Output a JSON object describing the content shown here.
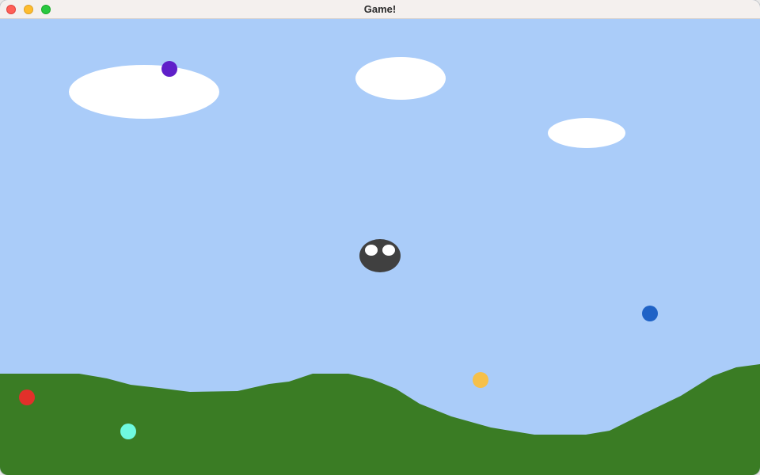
{
  "window": {
    "title": "Game!",
    "buttons": [
      {
        "name": "close",
        "color": "#ff5f57"
      },
      {
        "name": "minimize",
        "color": "#febc2e"
      },
      {
        "name": "maximize",
        "color": "#28c840"
      }
    ]
  },
  "colors": {
    "sky": "#aaccf9",
    "ground": "#3a7c24",
    "cloud": "#ffffff",
    "player_body": "#404040",
    "player_eye": "#ffffff"
  },
  "clouds": [
    "cloud",
    "cloud",
    "cloud"
  ],
  "player": {
    "name": "player",
    "eye_count": 2
  },
  "collectibles": [
    {
      "name": "purple-orb",
      "color": "#5f1fc9"
    },
    {
      "name": "blue-orb",
      "color": "#1f62c6"
    },
    {
      "name": "yellow-orb",
      "color": "#f6c04a"
    },
    {
      "name": "red-orb",
      "color": "#e2302a"
    },
    {
      "name": "aqua-orb",
      "color": "#6ffadf"
    }
  ]
}
